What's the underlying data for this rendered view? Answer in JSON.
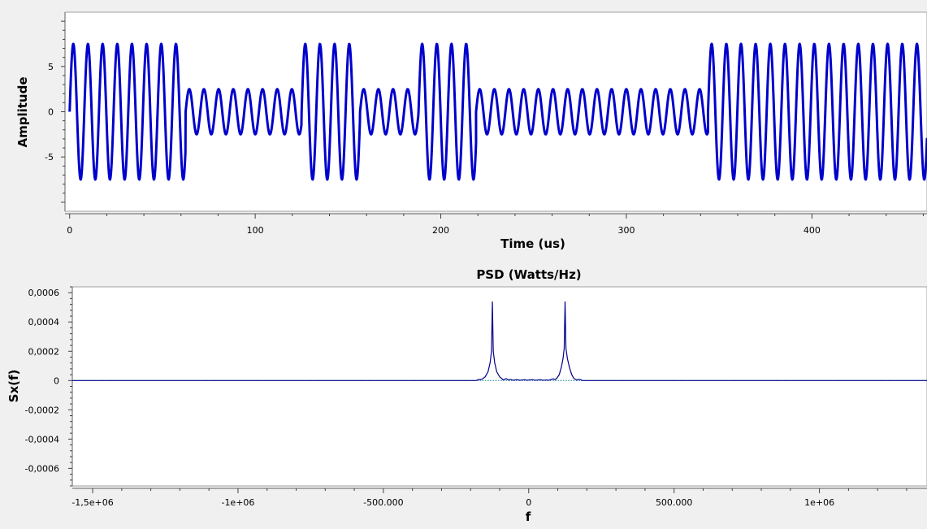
{
  "chart_data": [
    {
      "type": "line",
      "title": "",
      "xlabel": "Time (us)",
      "ylabel": "Amplitude",
      "xlim": [
        -2.5,
        462
      ],
      "ylim": [
        -11,
        11
      ],
      "xticks": [
        0,
        100,
        200,
        300,
        400
      ],
      "xtick_labels": [
        "0",
        "100",
        "200",
        "300",
        "400"
      ],
      "yticks": [
        5,
        0,
        -5
      ],
      "ytick_labels": [
        "5",
        "0",
        "-5"
      ],
      "grid": false,
      "series": [
        {
          "color": "#0000cc",
          "carrier_period_us": 7.9,
          "segments": [
            {
              "start": 0,
              "end": 62.5,
              "amplitude": 7.5
            },
            {
              "start": 62.5,
              "end": 125,
              "amplitude": 2.5
            },
            {
              "start": 125,
              "end": 156.5,
              "amplitude": 7.5
            },
            {
              "start": 156.5,
              "end": 188,
              "amplitude": 2.5
            },
            {
              "start": 188,
              "end": 219,
              "amplitude": 7.5
            },
            {
              "start": 219,
              "end": 344,
              "amplitude": 2.5
            },
            {
              "start": 344,
              "end": 462,
              "amplitude": 7.5
            }
          ]
        }
      ]
    },
    {
      "type": "line",
      "title": "PSD (Watts/Hz)",
      "xlabel": "f",
      "ylabel": "Sx(f)",
      "xlim": [
        -1570000,
        1370000
      ],
      "ylim": [
        -0.00072,
        0.00064
      ],
      "xticks": [
        -1500000,
        -1000000,
        -500000,
        0,
        500000,
        1000000
      ],
      "xtick_labels": [
        "-1,5e+06",
        "-1e+06",
        "-500.000",
        "0",
        "500.000",
        "1e+06"
      ],
      "yticks": [
        0.0006,
        0.0004,
        0.0002,
        0,
        -0.0002,
        -0.0004,
        -0.0006
      ],
      "ytick_labels": [
        "0,0006",
        "0,0004",
        "0,0002",
        "0",
        "-0,0002",
        "-0,0004",
        "-0,0006"
      ],
      "grid": false,
      "series": [
        {
          "color": "#00008b",
          "points": [
            [
              -1570000,
              0
            ],
            [
              -180000,
              0
            ],
            [
              -175000,
              5e-06
            ],
            [
              -165000,
              8e-06
            ],
            [
              -160000,
              1e-05
            ],
            [
              -150000,
              2.5e-05
            ],
            [
              -140000,
              6e-05
            ],
            [
              -133000,
              0.00012
            ],
            [
              -128000,
              0.0002
            ],
            [
              -125000,
              0.00054
            ],
            [
              -122000,
              0.0002
            ],
            [
              -117000,
              0.00012
            ],
            [
              -110000,
              6e-05
            ],
            [
              -100000,
              2.5e-05
            ],
            [
              -92000,
              1.2e-05
            ],
            [
              -88000,
              4e-06
            ],
            [
              -82000,
              1e-05
            ],
            [
              -76000,
              1.2e-05
            ],
            [
              -70000,
              4e-06
            ],
            [
              -62000,
              8e-06
            ],
            [
              -55000,
              2e-06
            ],
            [
              -40000,
              6e-06
            ],
            [
              -30000,
              2e-06
            ],
            [
              -15000,
              6e-06
            ],
            [
              -5000,
              2e-06
            ],
            [
              10000,
              6e-06
            ],
            [
              25000,
              2e-06
            ],
            [
              38000,
              6e-06
            ],
            [
              50000,
              2e-06
            ],
            [
              62000,
              4e-06
            ],
            [
              70000,
              2e-06
            ],
            [
              78000,
              8e-06
            ],
            [
              84000,
              1.2e-05
            ],
            [
              90000,
              6e-06
            ],
            [
              96000,
              1.4e-05
            ],
            [
              105000,
              4e-05
            ],
            [
              112000,
              9e-05
            ],
            [
              118000,
              0.00015
            ],
            [
              122000,
              0.00022
            ],
            [
              125000,
              0.00054
            ],
            [
              128000,
              0.00022
            ],
            [
              133000,
              0.00015
            ],
            [
              140000,
              9e-05
            ],
            [
              148000,
              4e-05
            ],
            [
              155000,
              1.5e-05
            ],
            [
              165000,
              4e-06
            ],
            [
              172000,
              8e-06
            ],
            [
              178000,
              6e-06
            ],
            [
              185000,
              0
            ],
            [
              1370000,
              0
            ]
          ]
        }
      ]
    }
  ]
}
